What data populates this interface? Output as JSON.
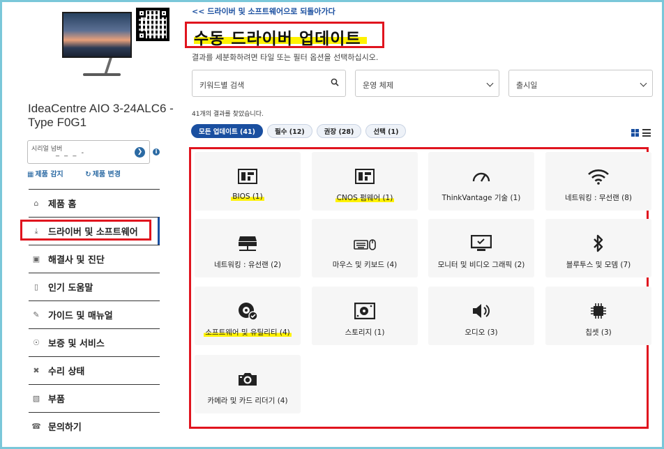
{
  "product": {
    "name": "IdeaCentre AIO 3-24ALC6 - Type F0G1",
    "serial_placeholder": "시리얼 넘버",
    "serial_masked": "_ _ _  -",
    "detect_label": "제품 감지",
    "change_label": "제품 변경"
  },
  "nav": {
    "items": [
      {
        "label": "제품 홈",
        "icon": "home-icon"
      },
      {
        "label": "드라이버 및 소프트웨어",
        "icon": "download-icon"
      },
      {
        "label": "해결사 및 진단",
        "icon": "diagnostic-icon"
      },
      {
        "label": "인기 도움말",
        "icon": "book-icon"
      },
      {
        "label": "가이드 및 매뉴얼",
        "icon": "guide-icon"
      },
      {
        "label": "보증 및 서비스",
        "icon": "shield-icon"
      },
      {
        "label": "수리 상태",
        "icon": "tools-icon"
      },
      {
        "label": "부품",
        "icon": "part-icon"
      },
      {
        "label": "문의하기",
        "icon": "headset-icon"
      }
    ],
    "active_index": 1
  },
  "header": {
    "back_link": "<< 드라이버 및 소프트웨어으로 되돌아가다",
    "title": "수동 드라이버 업데이트",
    "subtitle": "결과를 세분화하려면 타일 또는 필터 옵션을 선택하십시오."
  },
  "filters": {
    "search_placeholder": "키워드별 검색",
    "os_label": "운영 체제",
    "release_label": "출시일"
  },
  "results": {
    "count_text": "41개의 결과를 찾았습니다.",
    "pills": [
      {
        "label": "모든 업데이트 (41)",
        "active": true
      },
      {
        "label": "필수 (12)",
        "active": false
      },
      {
        "label": "권장 (28)",
        "active": false
      },
      {
        "label": "선택 (1)",
        "active": false
      }
    ]
  },
  "tiles": [
    {
      "label": "BIOS (1)",
      "icon": "bios-chip-icon",
      "highlight": true
    },
    {
      "label": "CNOS 펌웨어 (1)",
      "icon": "firmware-chip-icon",
      "highlight": true
    },
    {
      "label": "ThinkVantage 기술 (1)",
      "icon": "gauge-icon",
      "highlight": false
    },
    {
      "label": "네트워킹 : 무선랜 (8)",
      "icon": "wifi-icon",
      "highlight": false
    },
    {
      "label": "네트워킹 : 유선랜 (2)",
      "icon": "network-switch-icon",
      "highlight": false
    },
    {
      "label": "마우스 및 키보드 (4)",
      "icon": "keyboard-mouse-icon",
      "highlight": false
    },
    {
      "label": "모니터 및 비디오 그래픽 (2)",
      "icon": "monitor-icon",
      "highlight": false
    },
    {
      "label": "블루투스 및 모뎀 (7)",
      "icon": "bluetooth-icon",
      "highlight": false
    },
    {
      "label": "소프트웨어 및 유틸리티 (4)",
      "icon": "software-disc-icon",
      "highlight": true
    },
    {
      "label": "스토리지 (1)",
      "icon": "hard-drive-icon",
      "highlight": false
    },
    {
      "label": "오디오 (3)",
      "icon": "speaker-icon",
      "highlight": false
    },
    {
      "label": "칩셋 (3)",
      "icon": "chipset-icon",
      "highlight": false
    },
    {
      "label": "카메라 및 카드 리더기 (4)",
      "icon": "camera-icon",
      "highlight": false
    }
  ],
  "colors": {
    "accent": "#1a4fa0",
    "annotation_red": "#e0141e",
    "highlight_yellow": "#fff200",
    "tile_bg": "#f6f6f6"
  }
}
